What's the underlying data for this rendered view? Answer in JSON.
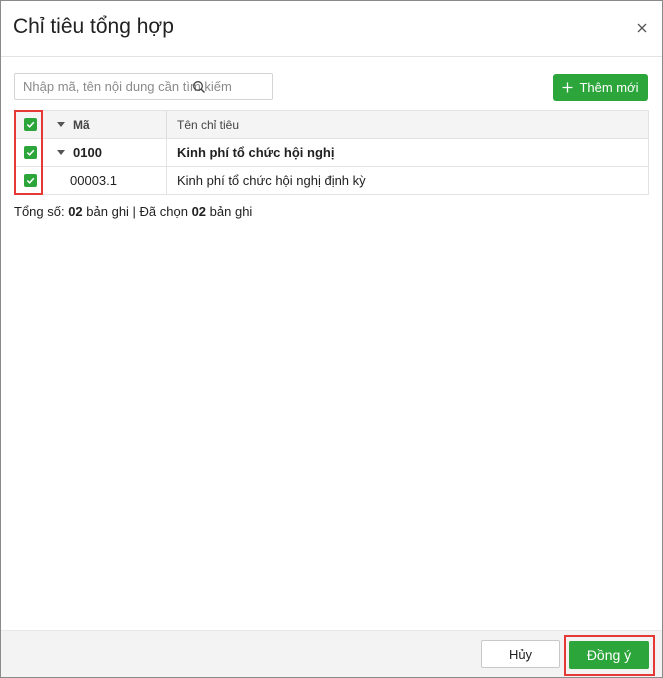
{
  "dialog": {
    "title": "Chỉ tiêu tổng hợp"
  },
  "search": {
    "placeholder": "Nhập mã, tên nội dung cần tìm kiếm",
    "value": ""
  },
  "toolbar": {
    "add_label": "Thêm mới"
  },
  "table": {
    "columns": [
      "Mã",
      "Tên chỉ tiêu"
    ],
    "rows": [
      {
        "code": "0100",
        "name": "Kinh phí tổ chức hội nghị",
        "checked": true,
        "is_group": true
      },
      {
        "code": "00003.1",
        "name": "Kinh phí tổ chức hội nghị định kỳ",
        "checked": true,
        "is_group": false
      }
    ],
    "header_checked": true
  },
  "summary": {
    "total_prefix": "Tổng số: ",
    "total_count": "02",
    "total_suffix": " bản ghi | Đã chọn ",
    "selected_count": "02",
    "selected_suffix": " bản ghi"
  },
  "footer": {
    "cancel_label": "Hủy",
    "ok_label": "Đồng ý"
  },
  "colors": {
    "accent": "#2ca53b",
    "highlight": "#e53935"
  }
}
